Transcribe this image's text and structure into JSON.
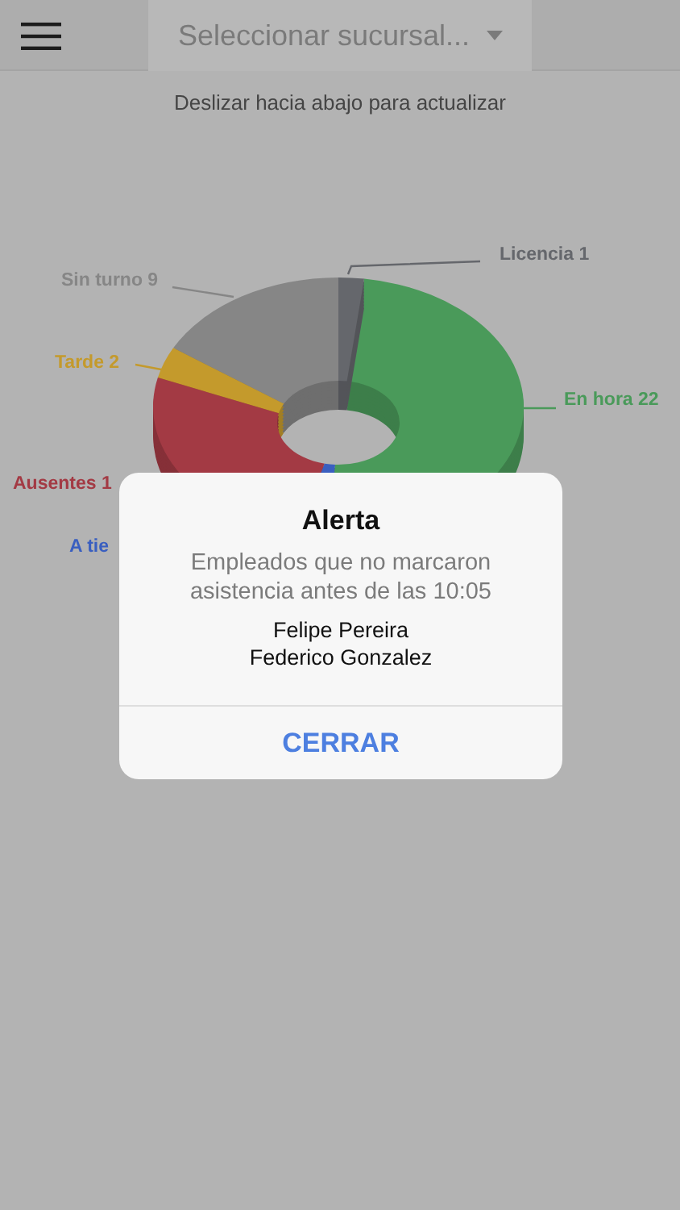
{
  "header": {
    "select_placeholder": "Seleccionar sucursal..."
  },
  "pull_hint": "Deslizar hacia abajo para actualizar",
  "chart": {
    "labels": [
      {
        "text": "Licencia 1",
        "color": "#65676c"
      },
      {
        "text": "Sin turno 9",
        "color": "#868686"
      },
      {
        "text": "Tarde 2",
        "color": "#c49a2c"
      },
      {
        "text": "En hora 22",
        "color": "#4a9a5a"
      },
      {
        "text": "Ausentes 1",
        "color": "#a33a44"
      },
      {
        "text": "A tie",
        "color": "#3a5fc0"
      }
    ]
  },
  "dialog": {
    "title": "Alerta",
    "message": "Empleados que no marcaron asistencia antes de las 10:05",
    "names": [
      "Felipe Pereira",
      "Federico Gonzalez"
    ],
    "button": "CERRAR"
  }
}
